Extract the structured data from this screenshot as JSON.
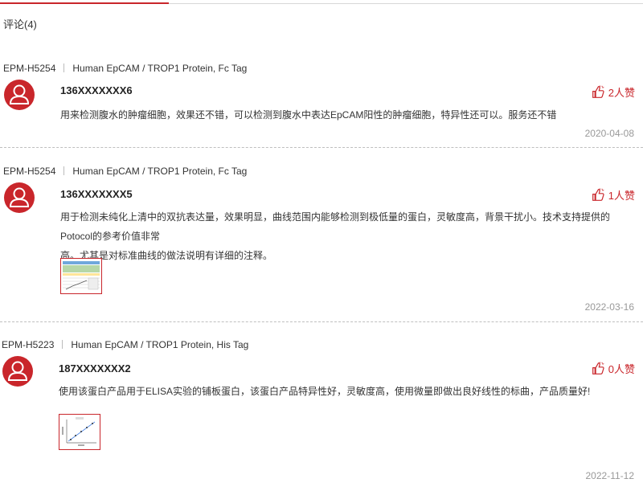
{
  "tab_accent_color": "#c9262b",
  "header": {
    "title": "评论(4)"
  },
  "reviews": [
    {
      "code": "EPM-H5254",
      "product": "Human EpCAM / TROP1 Protein, Fc Tag",
      "user": "136XXXXXXX6",
      "likes": "2人赞",
      "text_lines": [
        "用来检测腹水的肿瘤细胞，效果还不错，可以检测到腹水中表达EpCAM阳性的肿瘤细胞，特异性还可以。服务还不错"
      ],
      "date": "2020-04-08",
      "avatar_icon": "user-avatar-icon",
      "like_icon": "thumbs-up-icon"
    },
    {
      "code": "EPM-H5254",
      "product": "Human EpCAM / TROP1 Protein, Fc Tag",
      "user": "136XXXXXXX5",
      "likes": "1人赞",
      "text_lines": [
        "用于检测未纯化上清中的双抗表达量，效果明显，曲线范围内能够检测到极低量的蛋白，灵敏度高，背景干扰小。技术支持提供的Potocol的参考价值非常",
        "高。尤其是对标准曲线的做法说明有详细的注释。"
      ],
      "date": "2022-03-16",
      "avatar_icon": "user-avatar-icon",
      "like_icon": "thumbs-up-icon",
      "attachment_icon": "spreadsheet-thumbnail-icon"
    },
    {
      "code": "EPM-H5223",
      "product": "Human EpCAM / TROP1 Protein, His Tag",
      "user": "187XXXXXXX2",
      "likes": "0人赞",
      "text_lines": [
        "使用该蛋白产品用于ELISA实验的铺板蛋白，该蛋白产品特异性好，灵敏度高，使用微量即做出良好线性的标曲，产品质量好!"
      ],
      "date": "2022-11-12",
      "avatar_icon": "user-avatar-icon",
      "like_icon": "thumbs-up-icon",
      "attachment_icon": "standard-curve-thumbnail-icon"
    }
  ]
}
